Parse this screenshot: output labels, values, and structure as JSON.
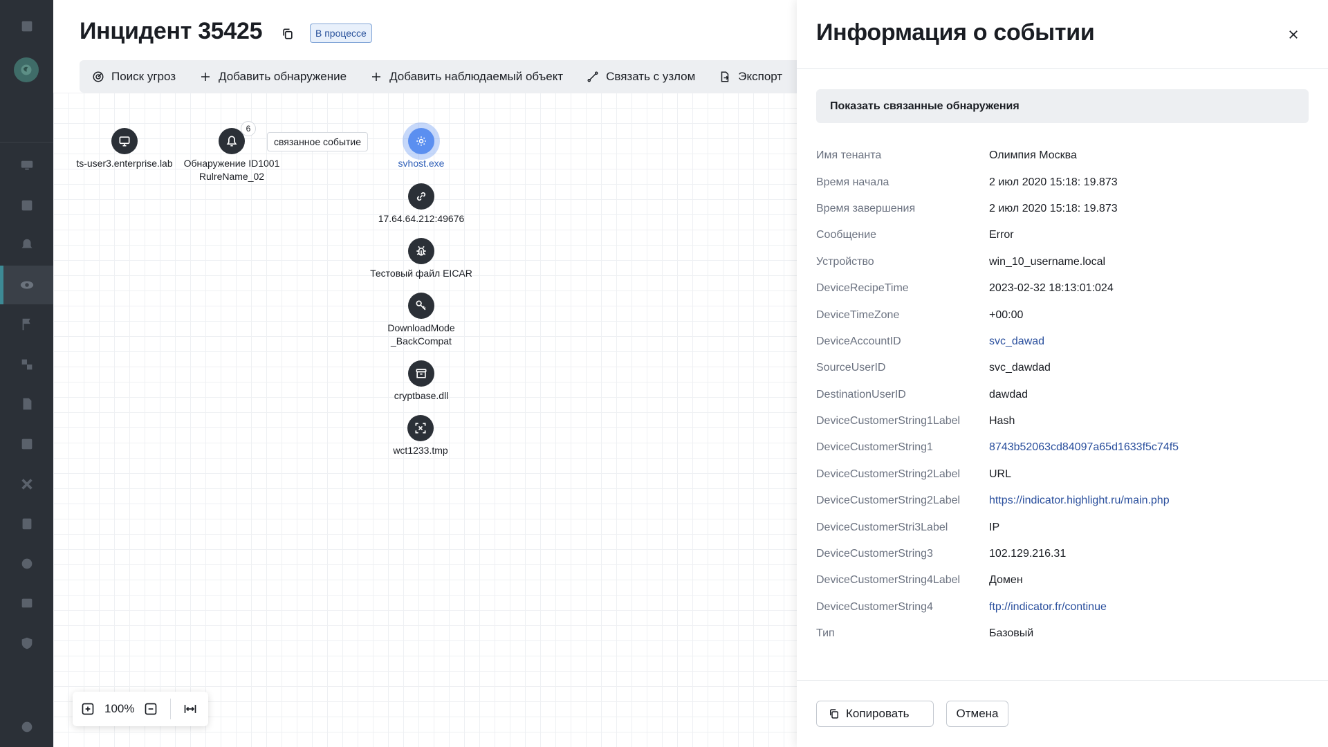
{
  "incident": {
    "title": "Инцидент 35425",
    "status": "В процессе"
  },
  "toolbar": {
    "threat_hunt": "Поиск угроз",
    "add_detection": "Добавить обнаружение",
    "add_observable": "Добавить наблюдаемый объект",
    "link_node": "Связать с узлом",
    "export": "Экспорт"
  },
  "graph": {
    "host": {
      "label": "ts-user3.enterprise.lab",
      "icon": "monitor-icon"
    },
    "detection": {
      "label_line1": "Обнаружение ID1001",
      "label_line2": "RulreName_02",
      "count": "6",
      "icon": "bell-icon"
    },
    "edge_label": "связанное событие",
    "process": {
      "label": "svhost.exe",
      "icon": "gear-icon"
    },
    "ip": {
      "label": "17.64.64.212:49676",
      "icon": "link-icon"
    },
    "eicar": {
      "label": "Тестовый файл EICAR",
      "icon": "bug-icon"
    },
    "registry": {
      "label_line1": "DownloadMode",
      "label_line2": "_BackCompat",
      "icon": "key-icon"
    },
    "dll": {
      "label": "cryptbase.dll",
      "icon": "archive-icon"
    },
    "tmp": {
      "label": "wct1233.tmp",
      "icon": "scan-icon"
    }
  },
  "zoom": {
    "value": "100%"
  },
  "panel": {
    "title": "Информация о событии",
    "show_related": "Показать связанные обнаружения",
    "fields": [
      {
        "key": "Имя тенанта",
        "value": "Олимпия Москва",
        "link": false
      },
      {
        "key": "Время начала",
        "value": "2 июл 2020 15:18: 19.873",
        "link": false
      },
      {
        "key": "Время завершения",
        "value": "2 июл 2020 15:18: 19.873",
        "link": false
      },
      {
        "key": "Сообщение",
        "value": "Error",
        "link": false
      },
      {
        "key": "Устройство",
        "value": "win_10_username.local",
        "link": false
      },
      {
        "key": "DeviceRecipeTime",
        "value": "2023-02-32 18:13:01:024",
        "link": false
      },
      {
        "key": "DeviceTimeZone",
        "value": "+00:00",
        "link": false
      },
      {
        "key": "DeviceAccountID",
        "value": "svc_dawad",
        "link": true
      },
      {
        "key": "SourceUserID",
        "value": "svc_dawdad",
        "link": false
      },
      {
        "key": "DestinationUserID",
        "value": "dawdad",
        "link": false
      },
      {
        "key": "DeviceCustomerString1Label",
        "value": "Hash",
        "link": false
      },
      {
        "key": "DeviceCustomerString1",
        "value": "8743b52063cd84097a65d1633f5c74f5",
        "link": true
      },
      {
        "key": "DeviceCustomerString2Label",
        "value": "URL",
        "link": false
      },
      {
        "key": "DeviceCustomerString2Label",
        "value": "https://indicator.highlight.ru/main.php",
        "link": true
      },
      {
        "key": "DeviceCustomerStri3Label",
        "value": "IP",
        "link": false
      },
      {
        "key": "DeviceCustomerString3",
        "value": "102.129.216.31",
        "link": false
      },
      {
        "key": "DeviceCustomerString4Label",
        "value": "Домен",
        "link": false
      },
      {
        "key": "DeviceCustomerString4",
        "value": "ftp://indicator.fr/continue",
        "link": true
      },
      {
        "key": "Тип",
        "value": "Базовый",
        "link": false
      }
    ],
    "copy_button": "Копировать",
    "cancel_button": "Отмена"
  },
  "colors": {
    "rail": "#2b3037",
    "accent_teal": "#3d8a95",
    "selected_node": "#5b8ff0",
    "link": "#2a4f9d",
    "status_badge_bg": "#e8f0fb"
  }
}
